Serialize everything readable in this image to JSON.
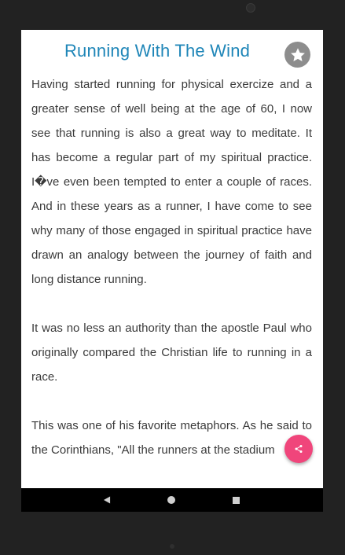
{
  "article": {
    "title": "Running With The Wind",
    "paragraphs": [
      "Having started running for physical exercize and a greater sense of well being at the age of 60, I now see that running is also a great way to meditate. It has become a regular part of my spiritual practice. I�ve even been tempted to enter a couple of races. And in these years as a runner, I have come to see why many of those engaged in spiritual practice have drawn an analogy between the journey of faith and long distance running.",
      "It was no less an authority than the apostle Paul who originally compared the Christian life to running in a race.",
      "This was one of his favorite metaphors. As he said to the Corinthians, \"All the runners at the stadium"
    ]
  },
  "icons": {
    "favorite": "star-icon",
    "share": "share-icon",
    "nav_back": "back-triangle-icon",
    "nav_home": "home-circle-icon",
    "nav_recents": "recents-square-icon"
  },
  "colors": {
    "title": "#1f86b8",
    "share_fab": "#f0457b",
    "favorite_button": "#8d8d8d"
  }
}
